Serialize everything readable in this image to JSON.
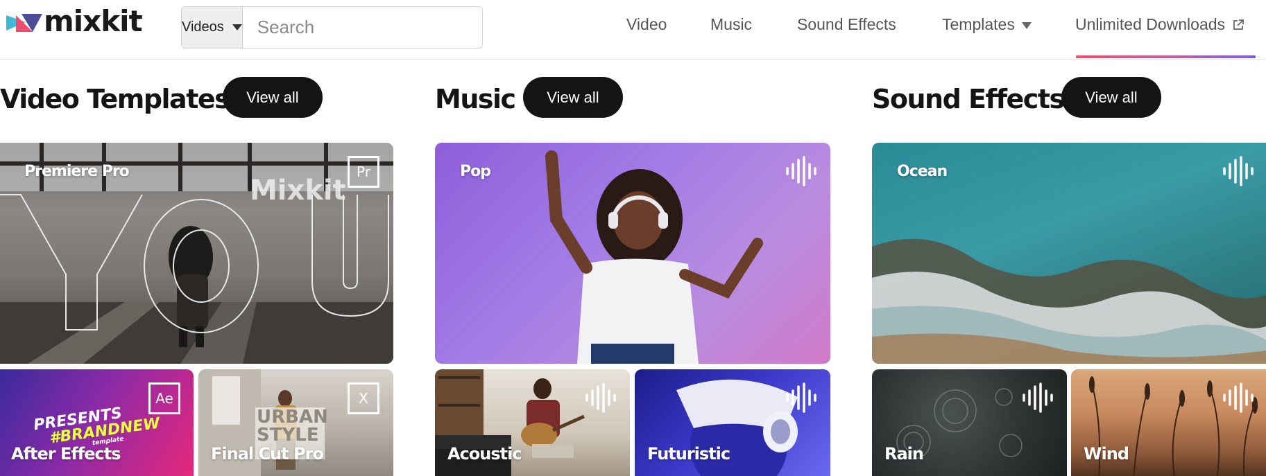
{
  "header": {
    "logo_text": "mixkit",
    "search": {
      "type_label": "Videos",
      "placeholder": "Search"
    },
    "nav": [
      {
        "label": "Video"
      },
      {
        "label": "Music"
      },
      {
        "label": "Sound Effects"
      },
      {
        "label": "Templates"
      },
      {
        "label": "Unlimited Downloads"
      }
    ]
  },
  "sections": {
    "video_templates": {
      "title": "Video Templates",
      "view_all": "View all",
      "main": {
        "label": "Premiere Pro",
        "badge": "Pr",
        "overlay_text": "Mixkit",
        "big_text": "YOU"
      },
      "sub": [
        {
          "label": "After Effects",
          "badge": "Ae",
          "art_line1": "PRESENTS",
          "art_line2": "#BRANDNEW",
          "art_line3": "template"
        },
        {
          "label": "Final Cut Pro",
          "badge": "X",
          "art_line1": "URBAN",
          "art_line2": "STYLE"
        }
      ]
    },
    "music": {
      "title": "Music",
      "view_all": "View all",
      "main": {
        "label": "Pop"
      },
      "sub": [
        {
          "label": "Acoustic"
        },
        {
          "label": "Futuristic"
        }
      ]
    },
    "sound_effects": {
      "title": "Sound Effects",
      "view_all": "View all",
      "main": {
        "label": "Ocean"
      },
      "sub": [
        {
          "label": "Rain"
        },
        {
          "label": "Wind"
        }
      ]
    }
  },
  "colors": {
    "accent_gradient_start": "#f24c6d",
    "accent_gradient_end": "#7a5cd9",
    "button_bg": "#141414",
    "text_dark": "#1a1a1a"
  },
  "icons": [
    "search-icon",
    "external-link-icon",
    "waveform-icon",
    "dropdown-caret-icon"
  ]
}
